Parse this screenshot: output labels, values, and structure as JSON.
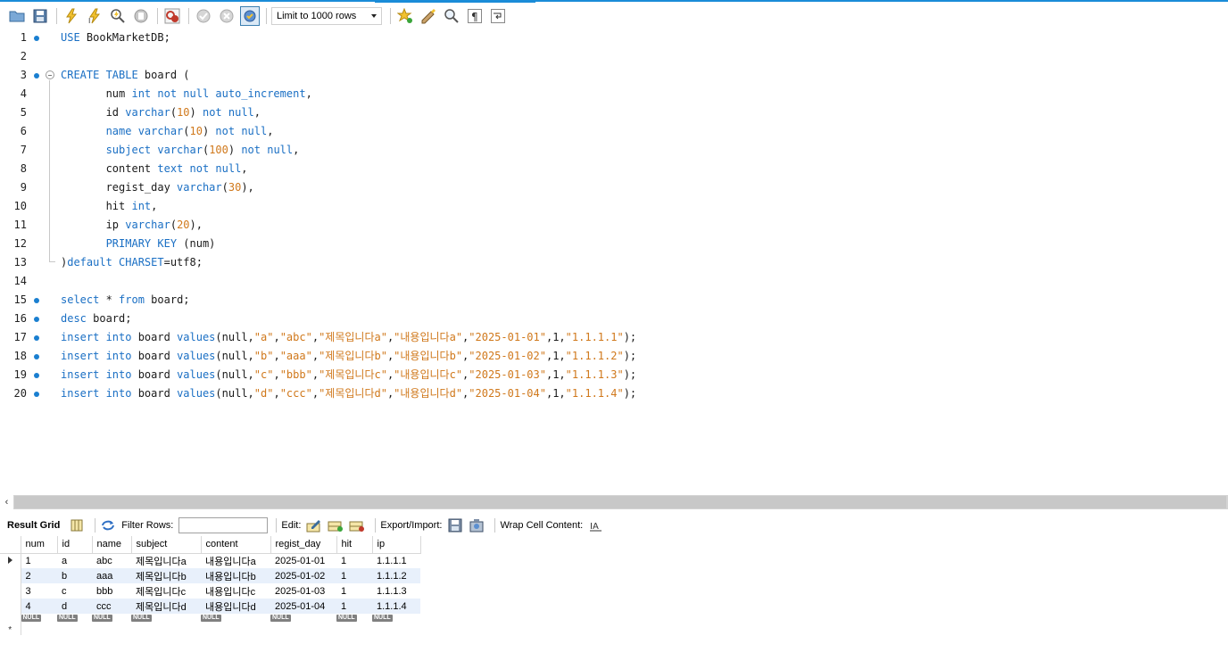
{
  "toolbar": {
    "limit_select": "Limit to 1000 rows",
    "buttons": [
      "open-folder-icon",
      "save-icon",
      "execute-icon",
      "execute-current-icon",
      "explain-icon",
      "stop-icon",
      "toggle-error-icon",
      "commit-icon",
      "rollback-icon",
      "autocommit-icon",
      "bookmark-icon",
      "beautify-icon",
      "find-icon",
      "invisible-chars-icon",
      "wrap-icon"
    ]
  },
  "editor": {
    "lines": [
      {
        "n": "1",
        "bp": true,
        "tokens": [
          [
            "kw",
            "USE"
          ],
          [
            "t",
            " BookMarketDB;"
          ]
        ]
      },
      {
        "n": "2",
        "bp": false,
        "tokens": []
      },
      {
        "n": "3",
        "bp": true,
        "fold": true,
        "tokens": [
          [
            "kw",
            "CREATE TABLE"
          ],
          [
            "t",
            " board ("
          ]
        ]
      },
      {
        "n": "4",
        "bp": false,
        "tokens": [
          [
            "t",
            "       num "
          ],
          [
            "kw",
            "int not null auto_increment"
          ],
          [
            "t",
            ","
          ]
        ]
      },
      {
        "n": "5",
        "bp": false,
        "tokens": [
          [
            "t",
            "       id "
          ],
          [
            "kw",
            "varchar"
          ],
          [
            "t",
            "("
          ],
          [
            "num",
            "10"
          ],
          [
            "t",
            ") "
          ],
          [
            "kw",
            "not null"
          ],
          [
            "t",
            ","
          ]
        ]
      },
      {
        "n": "6",
        "bp": false,
        "tokens": [
          [
            "t",
            "       "
          ],
          [
            "kw",
            "name varchar"
          ],
          [
            "t",
            "("
          ],
          [
            "num",
            "10"
          ],
          [
            "t",
            ") "
          ],
          [
            "kw",
            "not null"
          ],
          [
            "t",
            ","
          ]
        ]
      },
      {
        "n": "7",
        "bp": false,
        "tokens": [
          [
            "t",
            "       "
          ],
          [
            "kw",
            "subject varchar"
          ],
          [
            "t",
            "("
          ],
          [
            "num",
            "100"
          ],
          [
            "t",
            ") "
          ],
          [
            "kw",
            "not null"
          ],
          [
            "t",
            ","
          ]
        ]
      },
      {
        "n": "8",
        "bp": false,
        "tokens": [
          [
            "t",
            "       content "
          ],
          [
            "kw",
            "text not null"
          ],
          [
            "t",
            ","
          ]
        ]
      },
      {
        "n": "9",
        "bp": false,
        "tokens": [
          [
            "t",
            "       regist_day "
          ],
          [
            "kw",
            "varchar"
          ],
          [
            "t",
            "("
          ],
          [
            "num",
            "30"
          ],
          [
            "t",
            "),"
          ]
        ]
      },
      {
        "n": "10",
        "bp": false,
        "tokens": [
          [
            "t",
            "       hit "
          ],
          [
            "kw",
            "int"
          ],
          [
            "t",
            ","
          ]
        ]
      },
      {
        "n": "11",
        "bp": false,
        "tokens": [
          [
            "t",
            "       ip "
          ],
          [
            "kw",
            "varchar"
          ],
          [
            "t",
            "("
          ],
          [
            "num",
            "20"
          ],
          [
            "t",
            "),"
          ]
        ]
      },
      {
        "n": "12",
        "bp": false,
        "tokens": [
          [
            "t",
            "       "
          ],
          [
            "kw",
            "PRIMARY KEY"
          ],
          [
            "t",
            " (num)"
          ]
        ]
      },
      {
        "n": "13",
        "bp": false,
        "foldend": true,
        "tokens": [
          [
            "t",
            ")"
          ],
          [
            "kw",
            "default CHARSET"
          ],
          [
            "t",
            "=utf8;"
          ]
        ]
      },
      {
        "n": "14",
        "bp": false,
        "tokens": []
      },
      {
        "n": "15",
        "bp": true,
        "tokens": [
          [
            "kw",
            "select"
          ],
          [
            "t",
            " * "
          ],
          [
            "kw",
            "from"
          ],
          [
            "t",
            " board;"
          ]
        ]
      },
      {
        "n": "16",
        "bp": true,
        "tokens": [
          [
            "kw",
            "desc"
          ],
          [
            "t",
            " board;"
          ]
        ]
      },
      {
        "n": "17",
        "bp": true,
        "tokens": [
          [
            "kw",
            "insert into"
          ],
          [
            "t",
            " board "
          ],
          [
            "kw",
            "values"
          ],
          [
            "t",
            "(null,"
          ],
          [
            "str",
            "\"a\""
          ],
          [
            "t",
            ","
          ],
          [
            "str",
            "\"abc\""
          ],
          [
            "t",
            ","
          ],
          [
            "str",
            "\"제목입니다a\""
          ],
          [
            "t",
            ","
          ],
          [
            "str",
            "\"내용입니다a\""
          ],
          [
            "t",
            ","
          ],
          [
            "str",
            "\"2025-01-01\""
          ],
          [
            "t",
            ",1,"
          ],
          [
            "str",
            "\"1.1.1.1\""
          ],
          [
            "t",
            ");"
          ]
        ]
      },
      {
        "n": "18",
        "bp": true,
        "tokens": [
          [
            "kw",
            "insert into"
          ],
          [
            "t",
            " board "
          ],
          [
            "kw",
            "values"
          ],
          [
            "t",
            "(null,"
          ],
          [
            "str",
            "\"b\""
          ],
          [
            "t",
            ","
          ],
          [
            "str",
            "\"aaa\""
          ],
          [
            "t",
            ","
          ],
          [
            "str",
            "\"제목입니다b\""
          ],
          [
            "t",
            ","
          ],
          [
            "str",
            "\"내용입니다b\""
          ],
          [
            "t",
            ","
          ],
          [
            "str",
            "\"2025-01-02\""
          ],
          [
            "t",
            ",1,"
          ],
          [
            "str",
            "\"1.1.1.2\""
          ],
          [
            "t",
            ");"
          ]
        ]
      },
      {
        "n": "19",
        "bp": true,
        "tokens": [
          [
            "kw",
            "insert into"
          ],
          [
            "t",
            " board "
          ],
          [
            "kw",
            "values"
          ],
          [
            "t",
            "(null,"
          ],
          [
            "str",
            "\"c\""
          ],
          [
            "t",
            ","
          ],
          [
            "str",
            "\"bbb\""
          ],
          [
            "t",
            ","
          ],
          [
            "str",
            "\"제목입니다c\""
          ],
          [
            "t",
            ","
          ],
          [
            "str",
            "\"내용입니다c\""
          ],
          [
            "t",
            ","
          ],
          [
            "str",
            "\"2025-01-03\""
          ],
          [
            "t",
            ",1,"
          ],
          [
            "str",
            "\"1.1.1.3\""
          ],
          [
            "t",
            ");"
          ]
        ]
      },
      {
        "n": "20",
        "bp": true,
        "tokens": [
          [
            "kw",
            "insert into"
          ],
          [
            "t",
            " board "
          ],
          [
            "kw",
            "values"
          ],
          [
            "t",
            "(null,"
          ],
          [
            "str",
            "\"d\""
          ],
          [
            "t",
            ","
          ],
          [
            "str",
            "\"ccc\""
          ],
          [
            "t",
            ","
          ],
          [
            "str",
            "\"제목입니다d\""
          ],
          [
            "t",
            ","
          ],
          [
            "str",
            "\"내용입니다d\""
          ],
          [
            "t",
            ","
          ],
          [
            "str",
            "\"2025-01-04\""
          ],
          [
            "t",
            ",1,"
          ],
          [
            "str",
            "\"1.1.1.4\""
          ],
          [
            "t",
            ");"
          ]
        ]
      }
    ]
  },
  "result_toolbar": {
    "result_grid": "Result Grid",
    "filter_rows": "Filter Rows:",
    "filter_value": "",
    "edit": "Edit:",
    "export_import": "Export/Import:",
    "wrap_cell": "Wrap Cell Content:"
  },
  "grid": {
    "columns": [
      "num",
      "id",
      "name",
      "subject",
      "content",
      "regist_day",
      "hit",
      "ip"
    ],
    "rows": [
      [
        "1",
        "a",
        "abc",
        "제목입니다a",
        "내용입니다a",
        "2025-01-01",
        "1",
        "1.1.1.1"
      ],
      [
        "2",
        "b",
        "aaa",
        "제목입니다b",
        "내용입니다b",
        "2025-01-02",
        "1",
        "1.1.1.2"
      ],
      [
        "3",
        "c",
        "bbb",
        "제목입니다c",
        "내용입니다c",
        "2025-01-03",
        "1",
        "1.1.1.3"
      ],
      [
        "4",
        "d",
        "ccc",
        "제목입니다d",
        "내용입니다d",
        "2025-01-04",
        "1",
        "1.1.1.4"
      ]
    ],
    "null_label": "NULL",
    "new_row_marker": "*"
  },
  "colors": {
    "keyword": "#1a6fc4",
    "string": "#d0781b",
    "accent": "#1a8cd8",
    "alt_row": "#e8f0fb"
  }
}
